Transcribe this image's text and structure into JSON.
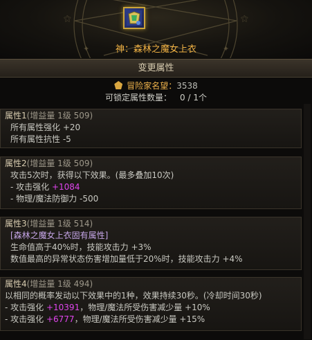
{
  "item": {
    "icon": "chest-armor-icon",
    "name": "神：森林之魔女上衣"
  },
  "title": "变更属性",
  "summary": {
    "reputation_label": "冒险家名望：",
    "reputation_value": "3538",
    "lockable_label": "可锁定属性数量：",
    "lockable_value": "0 / 1个"
  },
  "properties": [
    {
      "title": "属性1",
      "sub": "(增益量 1级 509)",
      "lines": [
        "所有属性强化 +20",
        "所有属性抗性 -5"
      ]
    },
    {
      "title": "属性2",
      "sub": "(增益量 1级 509)",
      "lines": [
        "攻击5次时，获得以下效果。(最多叠加10次)",
        {
          "prefix": "- 攻击强化 ",
          "highlight": "+1084",
          "suffix": ""
        },
        "- 物理/魔法防御力 -500"
      ]
    },
    {
      "title": "属性3",
      "sub": "(增益量 1级 514)",
      "special": "[森林之魔女上衣固有属性]",
      "lines": [
        "生命值高于40%时，技能攻击力 +3%",
        "数值最高的异常状态伤害增加量低于20%时，技能攻击力 +4%"
      ]
    },
    {
      "title": "属性4",
      "sub": "(增益量 1级 494)",
      "lines": [
        "以相同的概率发动以下效果中的1种，效果持续30秒。(冷却时间30秒)",
        {
          "prefix": "- 攻击强化 ",
          "highlight": "+10391",
          "suffix": "，物理/魔法所受伤害减少量 +10%"
        },
        {
          "prefix": "- 攻击强化 ",
          "highlight": "+6777",
          "suffix": "，物理/魔法所受伤害减少量 +15%"
        }
      ]
    }
  ],
  "colors": {
    "item_name": "#f1b244",
    "highlight": "#e045ee",
    "reputation": "#f0b44c"
  }
}
